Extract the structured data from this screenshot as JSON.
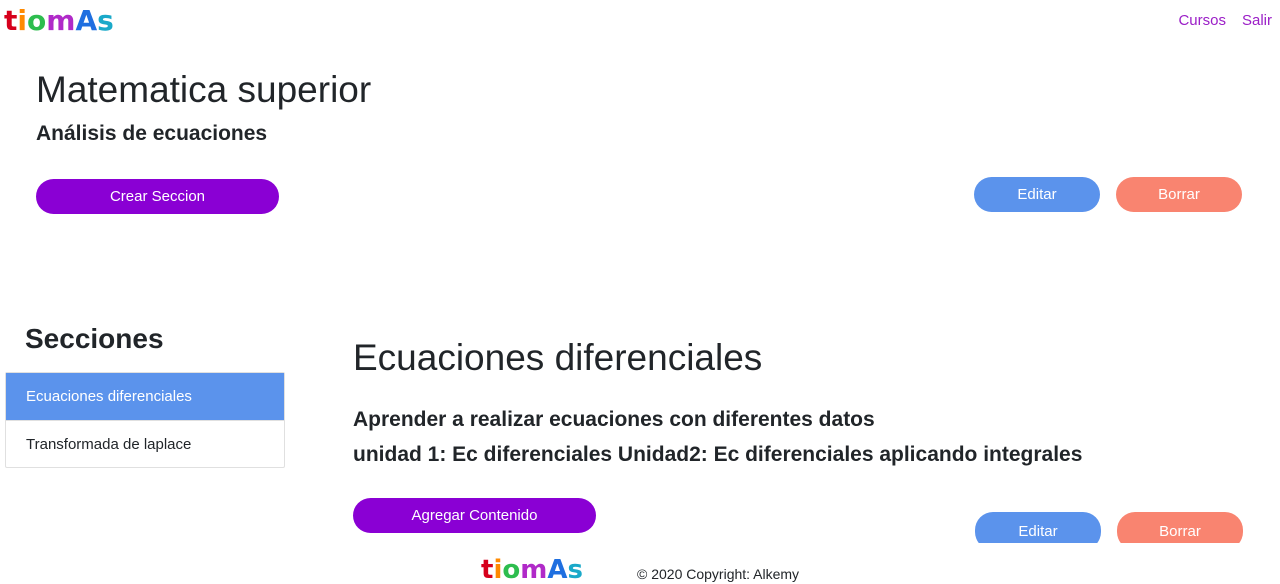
{
  "header": {
    "logo": [
      "t",
      "i",
      "o",
      "m",
      "A",
      "s"
    ],
    "nav": [
      {
        "label": "Cursos"
      },
      {
        "label": "Salir"
      }
    ]
  },
  "course": {
    "title": "Matematica superior",
    "subtitle": "Análisis de ecuaciones",
    "create_section_label": "Crear Seccion",
    "edit_label": "Editar",
    "delete_label": "Borrar"
  },
  "sections": {
    "heading": "Secciones",
    "items": [
      {
        "label": "Ecuaciones diferenciales",
        "active": true
      },
      {
        "label": "Transformada de laplace",
        "active": false
      }
    ]
  },
  "section_detail": {
    "title": "Ecuaciones diferenciales",
    "description": "Aprender a realizar ecuaciones con diferentes datos",
    "units": "unidad 1: Ec diferenciales Unidad2: Ec diferenciales aplicando integrales",
    "add_content_label": "Agregar Contenido",
    "edit_label": "Editar",
    "delete_label": "Borrar"
  },
  "footer": {
    "logo": [
      "t",
      "i",
      "o",
      "m",
      "A",
      "s"
    ],
    "copyright": "© 2020 Copyright: Alkemy"
  },
  "colors": {
    "brand_purple": "#8a00d4",
    "edit_blue": "#5b93ec",
    "delete_salmon": "#f98470",
    "nav_link": "#9b1ec7"
  }
}
